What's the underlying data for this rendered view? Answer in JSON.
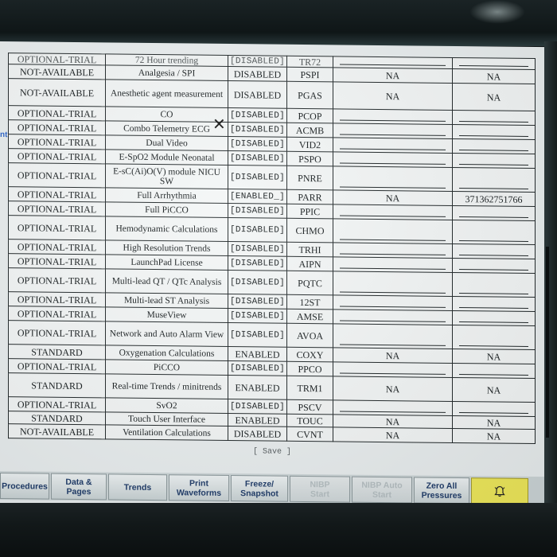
{
  "side_text": "nt",
  "table": {
    "rows": [
      {
        "status": "OPTIONAL-TRIAL",
        "feature": "72 Hour trending",
        "state": "[DISABLED]",
        "code": "TR72",
        "v1": "",
        "v2": "",
        "clip": true
      },
      {
        "status": "NOT-AVAILABLE",
        "feature": "Analgesia / SPI",
        "state": "DISABLED",
        "code": "PSPI",
        "v1": "NA",
        "v2": "NA"
      },
      {
        "status": "NOT-AVAILABLE",
        "feature": "Anesthetic agent measurement",
        "state": "DISABLED",
        "code": "PGAS",
        "v1": "NA",
        "v2": "NA"
      },
      {
        "status": "OPTIONAL-TRIAL",
        "feature": "CO",
        "state": "[DISABLED]",
        "code": "PCOP",
        "v1": "",
        "v2": ""
      },
      {
        "status": "OPTIONAL-TRIAL",
        "feature": "Combo Telemetry ECG",
        "state": "[DISABLED]",
        "code": "ACMB",
        "v1": "",
        "v2": ""
      },
      {
        "status": "OPTIONAL-TRIAL",
        "feature": "Dual Video",
        "state": "[DISABLED]",
        "code": "VID2",
        "v1": "",
        "v2": ""
      },
      {
        "status": "OPTIONAL-TRIAL",
        "feature": "E-SpO2 Module Neonatal",
        "state": "[DISABLED]",
        "code": "PSPO",
        "v1": "",
        "v2": ""
      },
      {
        "status": "OPTIONAL-TRIAL",
        "feature": "E-sC(Ai)O(V) module NICU SW",
        "state": "[DISABLED]",
        "code": "PNRE",
        "v1": "",
        "v2": ""
      },
      {
        "status": "OPTIONAL-TRIAL",
        "feature": "Full Arrhythmia",
        "state": "[ENABLED_]",
        "code": "PARR",
        "v1": "NA",
        "v2": "371362751766"
      },
      {
        "status": "OPTIONAL-TRIAL",
        "feature": "Full PiCCO",
        "state": "[DISABLED]",
        "code": "PPIC",
        "v1": "",
        "v2": ""
      },
      {
        "status": "OPTIONAL-TRIAL",
        "feature": "Hemodynamic Calculations",
        "state": "[DISABLED]",
        "code": "CHMO",
        "v1": "",
        "v2": ""
      },
      {
        "status": "OPTIONAL-TRIAL",
        "feature": "High Resolution Trends",
        "state": "[DISABLED]",
        "code": "TRHI",
        "v1": "",
        "v2": ""
      },
      {
        "status": "OPTIONAL-TRIAL",
        "feature": "LaunchPad License",
        "state": "[DISABLED]",
        "code": "AIPN",
        "v1": "",
        "v2": ""
      },
      {
        "status": "OPTIONAL-TRIAL",
        "feature": "Multi-lead QT / QTc Analysis",
        "state": "[DISABLED]",
        "code": "PQTC",
        "v1": "",
        "v2": ""
      },
      {
        "status": "OPTIONAL-TRIAL",
        "feature": "Multi-lead ST Analysis",
        "state": "[DISABLED]",
        "code": "12ST",
        "v1": "",
        "v2": ""
      },
      {
        "status": "OPTIONAL-TRIAL",
        "feature": "MuseView",
        "state": "[DISABLED]",
        "code": "AMSE",
        "v1": "",
        "v2": ""
      },
      {
        "status": "OPTIONAL-TRIAL",
        "feature": "Network and Auto Alarm View",
        "state": "[DISABLED]",
        "code": "AVOA",
        "v1": "",
        "v2": ""
      },
      {
        "status": "STANDARD",
        "feature": "Oxygenation Calculations",
        "state": "ENABLED",
        "code": "COXY",
        "v1": "NA",
        "v2": "NA"
      },
      {
        "status": "OPTIONAL-TRIAL",
        "feature": "PiCCO",
        "state": "[DISABLED]",
        "code": "PPCO",
        "v1": "",
        "v2": ""
      },
      {
        "status": "STANDARD",
        "feature": "Real-time Trends / minitrends",
        "state": "ENABLED",
        "code": "TRM1",
        "v1": "NA",
        "v2": "NA"
      },
      {
        "status": "OPTIONAL-TRIAL",
        "feature": "SvO2",
        "state": "[DISABLED]",
        "code": "PSCV",
        "v1": "",
        "v2": ""
      },
      {
        "status": "STANDARD",
        "feature": "Touch User Interface",
        "state": "ENABLED",
        "code": "TOUC",
        "v1": "NA",
        "v2": "NA"
      },
      {
        "status": "NOT-AVAILABLE",
        "feature": "Ventilation Calculations",
        "state": "DISABLED",
        "code": "CVNT",
        "v1": "NA",
        "v2": "NA"
      }
    ]
  },
  "close_glyph": "✕",
  "save_label": "[ Save ]",
  "toolbar": {
    "buttons": [
      {
        "name": "procedures-button",
        "label": "Procedures",
        "disabled": false
      },
      {
        "name": "data-pages-button",
        "label": "Data &\nPages",
        "disabled": false
      },
      {
        "name": "trends-button",
        "label": "Trends",
        "disabled": false
      },
      {
        "name": "print-waveforms-button",
        "label": "Print\nWaveforms",
        "disabled": false
      },
      {
        "name": "freeze-snapshot-button",
        "label": "Freeze/\nSnapshot",
        "disabled": false
      },
      {
        "name": "nibp-start-button",
        "label": "NIBP\nStart",
        "disabled": true
      },
      {
        "name": "nibp-auto-start-button",
        "label": "NIBP Auto\nStart",
        "disabled": true
      },
      {
        "name": "zero-all-pressures-button",
        "label": "Zero All\nPressures",
        "disabled": false
      }
    ],
    "alarm_color": "#efe95a",
    "alarm_icon": "alarm-bell-icon"
  }
}
